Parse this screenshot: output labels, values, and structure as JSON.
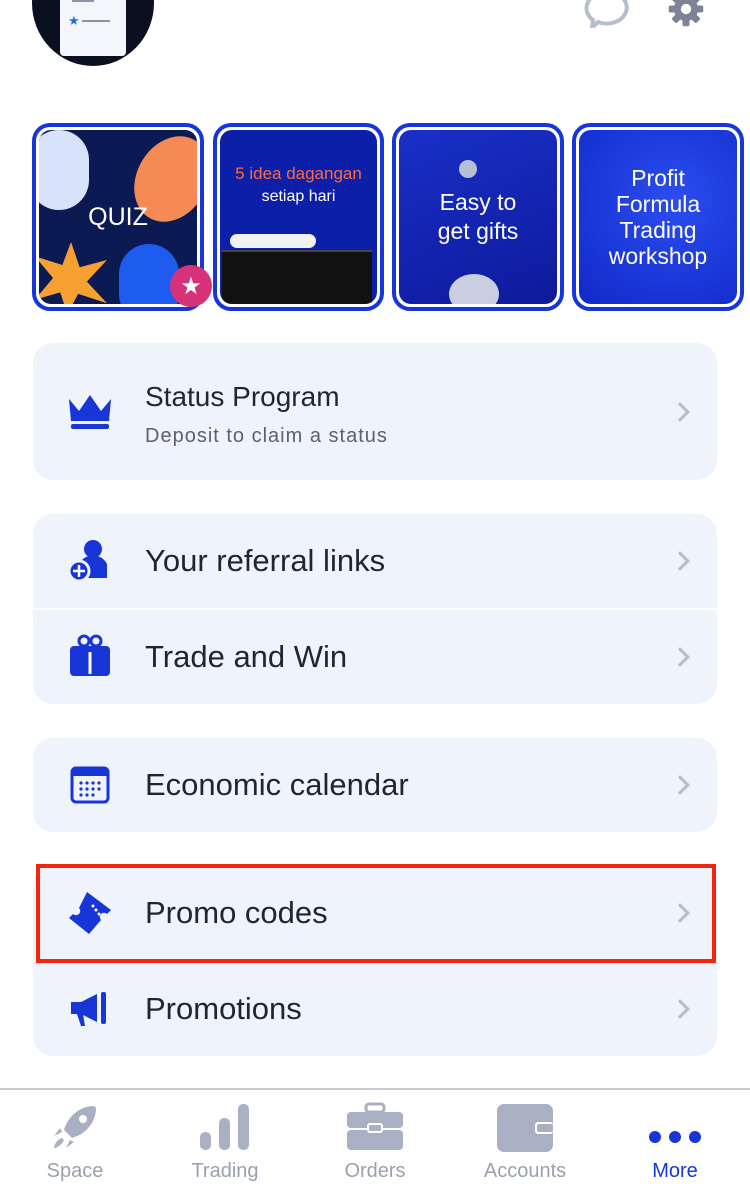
{
  "colors": {
    "accent": "#1836d8",
    "card_bg": "#eff3fc",
    "icon_grey": "#a9b0c3",
    "highlight": "#f2260f",
    "badge": "#d6327a"
  },
  "header": {
    "icons": [
      "chat-icon",
      "settings-gear-icon"
    ]
  },
  "stories": [
    {
      "text": "QUIZ",
      "badge": "star-icon"
    },
    {
      "title": "5 idea dagangan",
      "subtitle": "setiap hari"
    },
    {
      "text": "Easy to get gifts"
    },
    {
      "text": "Profit Formula Trading workshop"
    }
  ],
  "menu": {
    "status": {
      "title": "Status Program",
      "subtitle": "Deposit to claim a status",
      "icon": "crown-icon"
    },
    "referral": {
      "label": "Your referral links",
      "icon": "add-user-icon"
    },
    "trade_win": {
      "label": "Trade and Win",
      "icon": "gift-icon"
    },
    "calendar": {
      "label": "Economic calendar",
      "icon": "calendar-icon"
    },
    "promo_codes": {
      "label": "Promo codes",
      "icon": "ticket-icon",
      "highlighted": true
    },
    "promotions": {
      "label": "Promotions",
      "icon": "megaphone-icon"
    }
  },
  "tabbar": {
    "items": [
      {
        "label": "Space",
        "icon": "rocket-icon"
      },
      {
        "label": "Trading",
        "icon": "bar-chart-icon"
      },
      {
        "label": "Orders",
        "icon": "briefcase-icon"
      },
      {
        "label": "Accounts",
        "icon": "wallet-icon"
      },
      {
        "label": "More",
        "icon": "more-dots-icon",
        "active": true
      }
    ]
  }
}
